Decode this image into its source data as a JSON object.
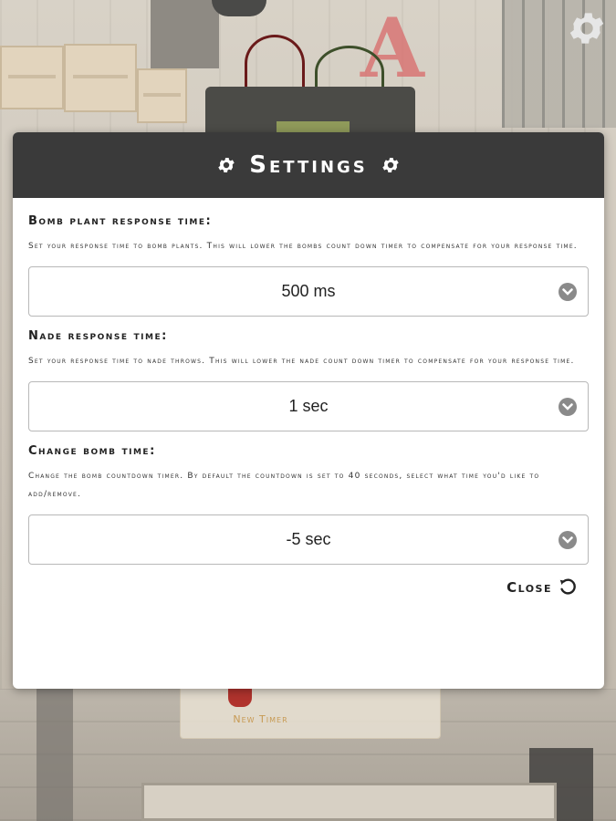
{
  "modal": {
    "title": "Settings",
    "sections": [
      {
        "title": "Bomb plant response time:",
        "description": "Set your response time to bomb plants. This will lower the bombs count down timer to compensate for your response time.",
        "selected": "500 ms"
      },
      {
        "title": "Nade response time:",
        "description": "Set your response time to nade throws. This will lower the nade count down timer to compensate for your response time.",
        "selected": "1 sec"
      },
      {
        "title": "Change Bomb Time:",
        "description": "Change the bomb countdown timer. By default the countdown is set to 40 seconds, select what time you'd like to add/remove.",
        "selected": "-5 sec"
      }
    ],
    "close_label": "Close"
  },
  "background": {
    "new_timer_label": "New Timer",
    "graffiti": "A"
  },
  "icons": {
    "settings": "gear-icon",
    "dropdown": "chevron-down-circle-icon",
    "close": "undo-icon"
  },
  "colors": {
    "header_bg": "#3a3a3a",
    "chevron": "#8a8a8a",
    "new_timer_text": "#c79a53"
  }
}
